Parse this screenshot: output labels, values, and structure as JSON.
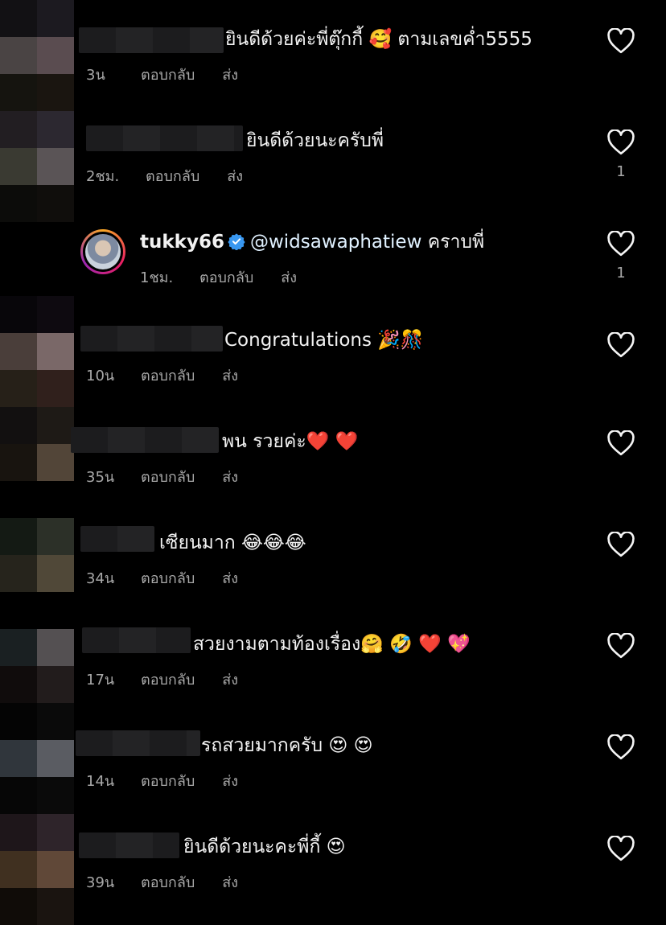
{
  "labels": {
    "reply": "ตอบกลับ",
    "send": "ส่ง"
  },
  "comments": [
    {
      "text": "ยินดีด้วยค่ะพี่ตุ๊กกี้ 🥰 ตามเลขค่ำ5555",
      "time": "3น",
      "likes": ""
    },
    {
      "text": "ยินดีด้วยนะครับพี่",
      "time": "2ชม.",
      "likes": "1"
    },
    {
      "username": "tukky66",
      "mention": "@widsawaphatiew",
      "text": " คราบพี่",
      "time": "1ชม.",
      "likes": "1"
    },
    {
      "text": "Congratulations 🎉🎊",
      "time": "10น",
      "likes": ""
    },
    {
      "text": "พน รวยค่ะ❤️ ❤️",
      "time": "35น",
      "likes": ""
    },
    {
      "text": "เซียนมาก 😂😂😂",
      "time": "34น",
      "likes": ""
    },
    {
      "text": "สวยงามตามท้องเรื่อง🤗 🤣 ❤️ 💖",
      "time": "17น",
      "likes": ""
    },
    {
      "text": "รถสวยมากครับ 😍 😍",
      "time": "14น",
      "likes": ""
    },
    {
      "text": "ยินดีด้วยนะคะพี่กี้ 😍",
      "time": "39น",
      "likes": ""
    }
  ],
  "colors": {
    "background": "#000000",
    "meta": "#a8a8a8",
    "verified": "#3897f0"
  },
  "icons": {
    "like": "heart-outline-icon",
    "verified": "verified-badge-icon"
  }
}
